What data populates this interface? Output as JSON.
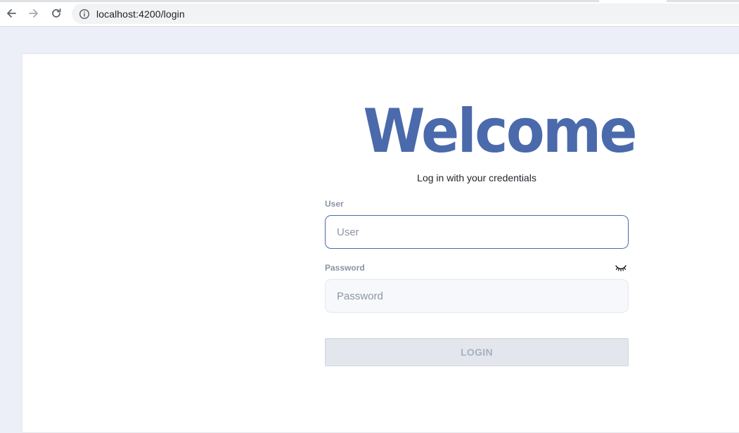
{
  "browser": {
    "url": "localhost:4200/login",
    "back_icon": "arrow-left-icon",
    "forward_icon": "arrow-right-icon",
    "reload_icon": "reload-icon",
    "site_info_icon": "info-circle-icon"
  },
  "login": {
    "title": "Welcome",
    "subtitle": "Log in with your credentials",
    "user_label": "User",
    "user_placeholder": "User",
    "user_value": "",
    "password_label": "Password",
    "password_placeholder": "Password",
    "password_value": "",
    "password_toggle_icon": "eye-closed-icon",
    "submit_label": "LOGIN"
  },
  "colors": {
    "brand": "#4a6aab",
    "page_background": "#eceff7",
    "card_background": "#ffffff",
    "disabled_button": "#e3e7ed",
    "disabled_button_text": "#a9b0bd",
    "label_text": "#8a94a6"
  }
}
